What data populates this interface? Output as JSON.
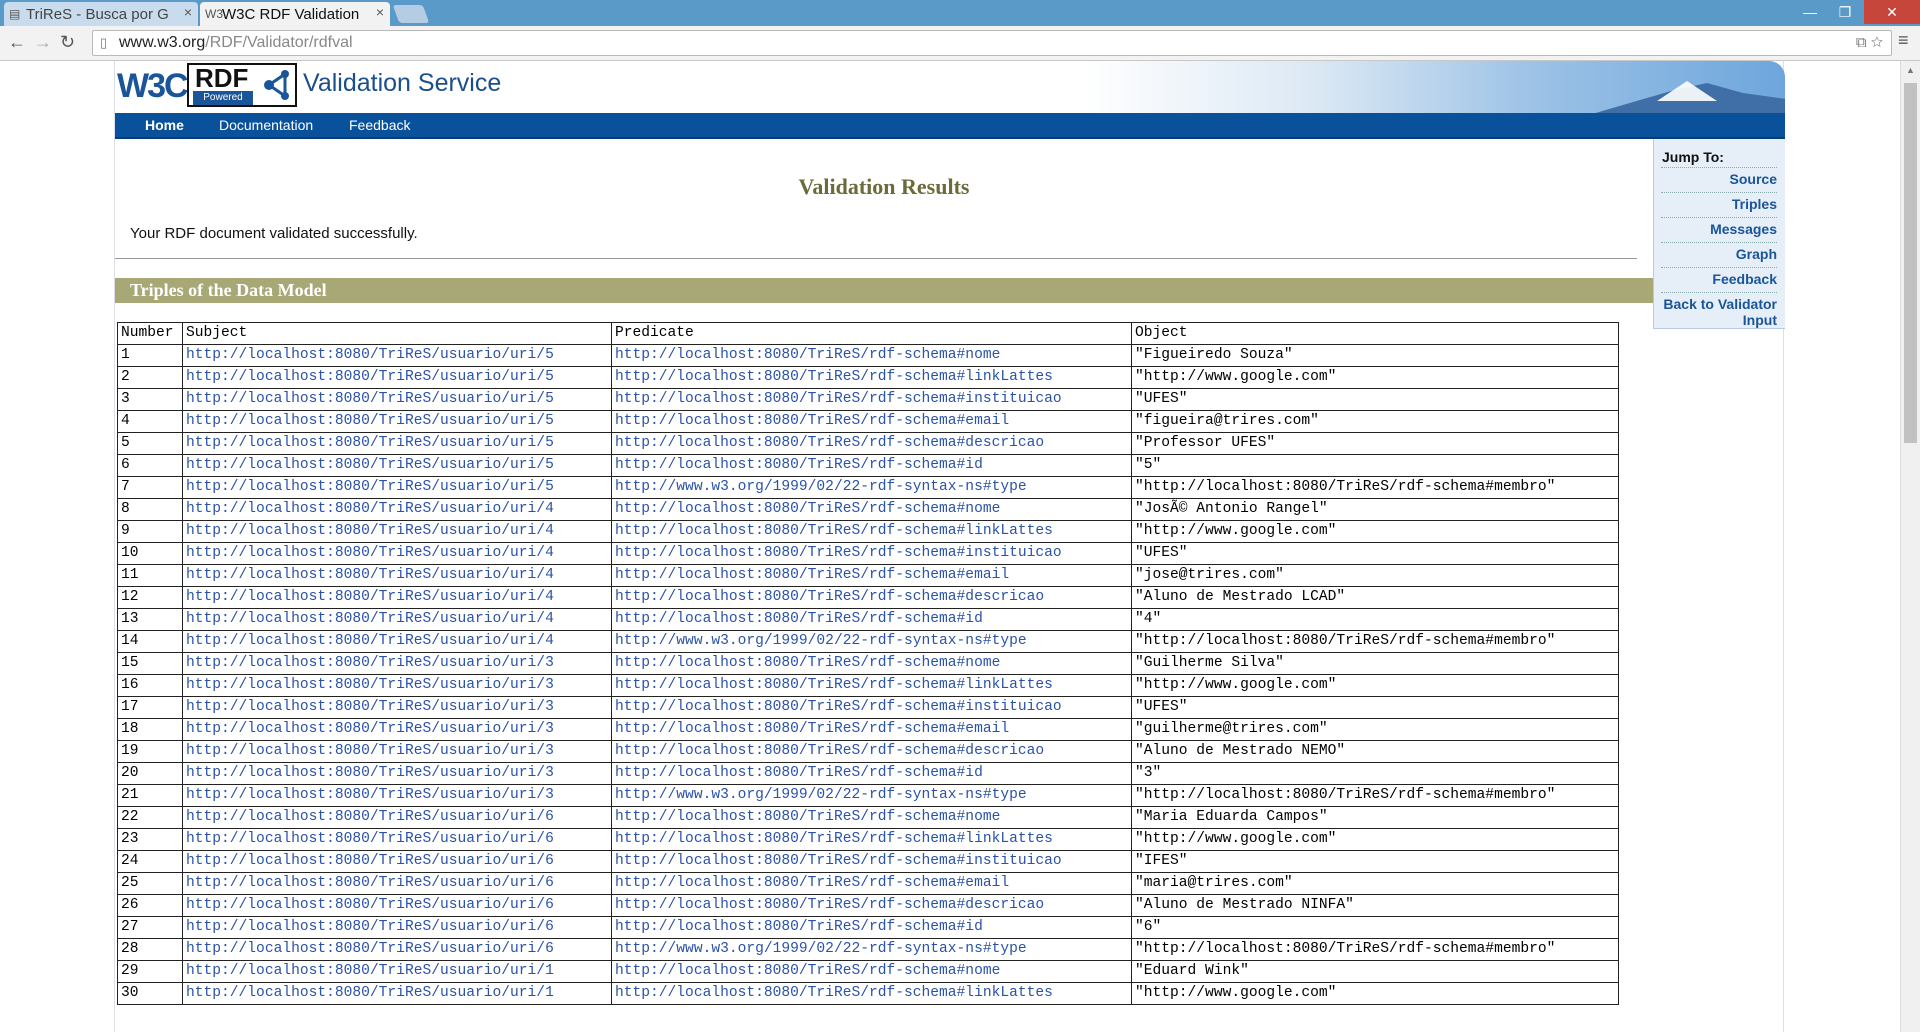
{
  "browser": {
    "tabs": [
      {
        "label": "TriReS - Busca por G"
      },
      {
        "label": "W3C RDF Validation"
      }
    ],
    "url_host": "www.w3.org",
    "url_path": "/RDF/Validator/rdfval"
  },
  "header": {
    "logo_w3c": "W3C",
    "logo_rdf": "RDF",
    "logo_powered": "Powered",
    "title": "Validation Service"
  },
  "nav": {
    "home": "Home",
    "documentation": "Documentation",
    "feedback": "Feedback"
  },
  "jump": {
    "header": "Jump To:",
    "links": [
      "Source",
      "Triples",
      "Messages",
      "Graph",
      "Feedback",
      "Back to Validator Input"
    ]
  },
  "main": {
    "title": "Validation Results",
    "message": "Your RDF document validated successfully.",
    "section_title": "Triples of the Data Model"
  },
  "table": {
    "headers": [
      "Number",
      "Subject",
      "Predicate",
      "Object"
    ],
    "rows": [
      [
        "1",
        "http://localhost:8080/TriReS/usuario/uri/5",
        "http://localhost:8080/TriReS/rdf-schema#nome",
        "\"Figueiredo Souza\""
      ],
      [
        "2",
        "http://localhost:8080/TriReS/usuario/uri/5",
        "http://localhost:8080/TriReS/rdf-schema#linkLattes",
        "\"http://www.google.com\""
      ],
      [
        "3",
        "http://localhost:8080/TriReS/usuario/uri/5",
        "http://localhost:8080/TriReS/rdf-schema#instituicao",
        "\"UFES\""
      ],
      [
        "4",
        "http://localhost:8080/TriReS/usuario/uri/5",
        "http://localhost:8080/TriReS/rdf-schema#email",
        "\"figueira@trires.com\""
      ],
      [
        "5",
        "http://localhost:8080/TriReS/usuario/uri/5",
        "http://localhost:8080/TriReS/rdf-schema#descricao",
        "\"Professor UFES\""
      ],
      [
        "6",
        "http://localhost:8080/TriReS/usuario/uri/5",
        "http://localhost:8080/TriReS/rdf-schema#id",
        "\"5\""
      ],
      [
        "7",
        "http://localhost:8080/TriReS/usuario/uri/5",
        "http://www.w3.org/1999/02/22-rdf-syntax-ns#type",
        "\"http://localhost:8080/TriReS/rdf-schema#membro\""
      ],
      [
        "8",
        "http://localhost:8080/TriReS/usuario/uri/4",
        "http://localhost:8080/TriReS/rdf-schema#nome",
        "\"JosÃ© Antonio Rangel\""
      ],
      [
        "9",
        "http://localhost:8080/TriReS/usuario/uri/4",
        "http://localhost:8080/TriReS/rdf-schema#linkLattes",
        "\"http://www.google.com\""
      ],
      [
        "10",
        "http://localhost:8080/TriReS/usuario/uri/4",
        "http://localhost:8080/TriReS/rdf-schema#instituicao",
        "\"UFES\""
      ],
      [
        "11",
        "http://localhost:8080/TriReS/usuario/uri/4",
        "http://localhost:8080/TriReS/rdf-schema#email",
        "\"jose@trires.com\""
      ],
      [
        "12",
        "http://localhost:8080/TriReS/usuario/uri/4",
        "http://localhost:8080/TriReS/rdf-schema#descricao",
        "\"Aluno de Mestrado LCAD\""
      ],
      [
        "13",
        "http://localhost:8080/TriReS/usuario/uri/4",
        "http://localhost:8080/TriReS/rdf-schema#id",
        "\"4\""
      ],
      [
        "14",
        "http://localhost:8080/TriReS/usuario/uri/4",
        "http://www.w3.org/1999/02/22-rdf-syntax-ns#type",
        "\"http://localhost:8080/TriReS/rdf-schema#membro\""
      ],
      [
        "15",
        "http://localhost:8080/TriReS/usuario/uri/3",
        "http://localhost:8080/TriReS/rdf-schema#nome",
        "\"Guilherme Silva\""
      ],
      [
        "16",
        "http://localhost:8080/TriReS/usuario/uri/3",
        "http://localhost:8080/TriReS/rdf-schema#linkLattes",
        "\"http://www.google.com\""
      ],
      [
        "17",
        "http://localhost:8080/TriReS/usuario/uri/3",
        "http://localhost:8080/TriReS/rdf-schema#instituicao",
        "\"UFES\""
      ],
      [
        "18",
        "http://localhost:8080/TriReS/usuario/uri/3",
        "http://localhost:8080/TriReS/rdf-schema#email",
        "\"guilherme@trires.com\""
      ],
      [
        "19",
        "http://localhost:8080/TriReS/usuario/uri/3",
        "http://localhost:8080/TriReS/rdf-schema#descricao",
        "\"Aluno de Mestrado NEMO\""
      ],
      [
        "20",
        "http://localhost:8080/TriReS/usuario/uri/3",
        "http://localhost:8080/TriReS/rdf-schema#id",
        "\"3\""
      ],
      [
        "21",
        "http://localhost:8080/TriReS/usuario/uri/3",
        "http://www.w3.org/1999/02/22-rdf-syntax-ns#type",
        "\"http://localhost:8080/TriReS/rdf-schema#membro\""
      ],
      [
        "22",
        "http://localhost:8080/TriReS/usuario/uri/6",
        "http://localhost:8080/TriReS/rdf-schema#nome",
        "\"Maria Eduarda Campos\""
      ],
      [
        "23",
        "http://localhost:8080/TriReS/usuario/uri/6",
        "http://localhost:8080/TriReS/rdf-schema#linkLattes",
        "\"http://www.google.com\""
      ],
      [
        "24",
        "http://localhost:8080/TriReS/usuario/uri/6",
        "http://localhost:8080/TriReS/rdf-schema#instituicao",
        "\"IFES\""
      ],
      [
        "25",
        "http://localhost:8080/TriReS/usuario/uri/6",
        "http://localhost:8080/TriReS/rdf-schema#email",
        "\"maria@trires.com\""
      ],
      [
        "26",
        "http://localhost:8080/TriReS/usuario/uri/6",
        "http://localhost:8080/TriReS/rdf-schema#descricao",
        "\"Aluno de Mestrado NINFA\""
      ],
      [
        "27",
        "http://localhost:8080/TriReS/usuario/uri/6",
        "http://localhost:8080/TriReS/rdf-schema#id",
        "\"6\""
      ],
      [
        "28",
        "http://localhost:8080/TriReS/usuario/uri/6",
        "http://www.w3.org/1999/02/22-rdf-syntax-ns#type",
        "\"http://localhost:8080/TriReS/rdf-schema#membro\""
      ],
      [
        "29",
        "http://localhost:8080/TriReS/usuario/uri/1",
        "http://localhost:8080/TriReS/rdf-schema#nome",
        "\"Eduard Wink\""
      ],
      [
        "30",
        "http://localhost:8080/TriReS/usuario/uri/1",
        "http://localhost:8080/TriReS/rdf-schema#linkLattes",
        "\"http://www.google.com\""
      ]
    ]
  },
  "colors": {
    "nav_bg": "#0a519b",
    "section_bg": "#a8a877",
    "title": "#6b6b3a",
    "link": "#2a52a8"
  }
}
